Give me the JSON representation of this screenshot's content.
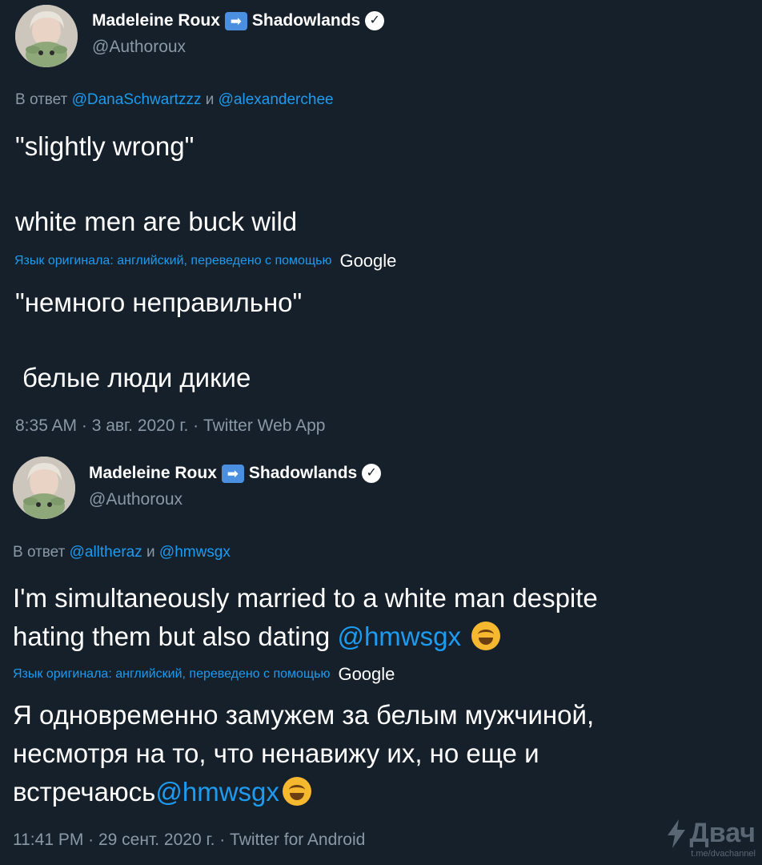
{
  "tweets": [
    {
      "author": {
        "name": "Madeleine Roux",
        "arrow_icon": "➡",
        "name_suffix": "Shadowlands",
        "handle": "@Authoroux",
        "verified_icon": "verified-badge-icon"
      },
      "reply_prefix": "В ответ",
      "reply_mention_1": "@DanaSchwartzzz",
      "reply_and": "и",
      "reply_mention_2": "@alexanderchee",
      "text_line_1": "\"slightly wrong\"",
      "text_line_2": "white men are buck wild",
      "translated_label": "Язык оригинала: английский, переведено с помощью",
      "translated_brand": "Google",
      "translation_line_1": "\"немного неправильно\"",
      "translation_line_2": "белые люди дикие",
      "meta": "8:35 AM · 3 авг. 2020 г. · Twitter Web App"
    },
    {
      "author": {
        "name": "Madeleine Roux",
        "arrow_icon": "➡",
        "name_suffix": "Shadowlands",
        "handle": "@Authoroux",
        "verified_icon": "verified-badge-icon"
      },
      "reply_prefix": "В ответ",
      "reply_mention_1": "@alltheraz",
      "reply_and": "и",
      "reply_mention_2": "@hmwsgx",
      "text_line_1": "I'm simultaneously married to a white man despite",
      "text_line_2": "hating them but also dating",
      "text_mention": "@hmwsgx",
      "translated_label": "Язык оригинала: английский, переведено с помощью",
      "translated_brand": "Google",
      "translation_line_1": "Я одновременно замужем за белым мужчиной,",
      "translation_line_2": "несмотря на то, что ненавижу их, но еще и",
      "translation_line_3": "встречаюсь",
      "translation_mention": "@hmwsgx",
      "meta": "11:41 PM · 29 сент. 2020 г. · Twitter for Android"
    }
  ],
  "watermark": {
    "brand": "Двач",
    "sub": "t.me/dvachannel"
  },
  "colors": {
    "background": "#15202b",
    "link": "#1d9bf0",
    "muted": "#8b98a5"
  }
}
